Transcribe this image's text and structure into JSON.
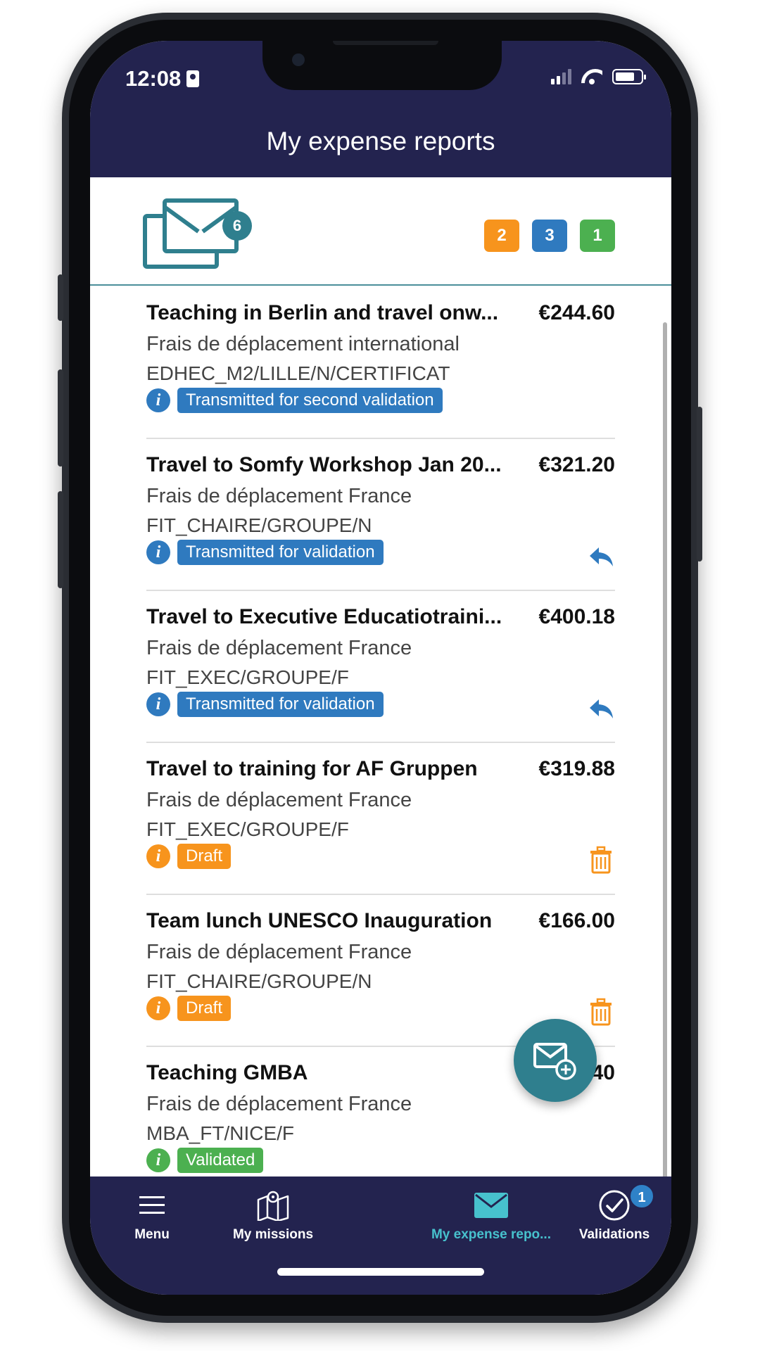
{
  "status_bar": {
    "time": "12:08"
  },
  "header": {
    "title": "My expense reports"
  },
  "summary": {
    "mail_count": "6",
    "counts": [
      {
        "value": "2",
        "color": "#f7941d"
      },
      {
        "value": "3",
        "color": "#2f7abf"
      },
      {
        "value": "1",
        "color": "#4cb050"
      }
    ]
  },
  "reports": [
    {
      "title": "Teaching in Berlin and travel onw...",
      "amount": "€244.60",
      "type": "Frais de déplacement international",
      "code": "EDHEC_M2/LILLE/N/CERTIFICAT",
      "status": "Transmitted for second validation",
      "status_color": "#2f7abf",
      "action": "none"
    },
    {
      "title": "Travel to Somfy Workshop Jan 20...",
      "amount": "€321.20",
      "type": "Frais de déplacement France",
      "code": "FIT_CHAIRE/GROUPE/N",
      "status": "Transmitted for validation",
      "status_color": "#2f7abf",
      "action": "reply-icon"
    },
    {
      "title": "Travel to Executive Educatiotraini...",
      "amount": "€400.18",
      "type": "Frais de déplacement France",
      "code": "FIT_EXEC/GROUPE/F",
      "status": "Transmitted for validation",
      "status_color": "#2f7abf",
      "action": "reply-icon"
    },
    {
      "title": "Travel to training for AF Gruppen",
      "amount": "€319.88",
      "type": "Frais de déplacement France",
      "code": "FIT_EXEC/GROUPE/F",
      "status": "Draft",
      "status_color": "#f7941d",
      "action": "trash-icon"
    },
    {
      "title": "Team lunch UNESCO Inauguration",
      "amount": "€166.00",
      "type": "Frais de déplacement France",
      "code": "FIT_CHAIRE/GROUPE/N",
      "status": "Draft",
      "status_color": "#f7941d",
      "action": "trash-icon"
    },
    {
      "title": "Teaching GMBA",
      "amount": "40",
      "type": "Frais de déplacement France",
      "code": "MBA_FT/NICE/F",
      "status": "Validated",
      "status_color": "#4cb050",
      "action": "none"
    }
  ],
  "tabbar": {
    "tabs": [
      {
        "label": "Menu",
        "icon": "menu-icon"
      },
      {
        "label": "My missions",
        "icon": "map-icon"
      },
      {
        "label": "My expense repo...",
        "icon": "mail-icon",
        "active": true
      },
      {
        "label": "Validations",
        "icon": "check-icon",
        "badge": "1"
      }
    ]
  },
  "colors": {
    "primary": "#23234f",
    "accent": "#2f7f8e",
    "active_tab": "#47c1cd"
  }
}
